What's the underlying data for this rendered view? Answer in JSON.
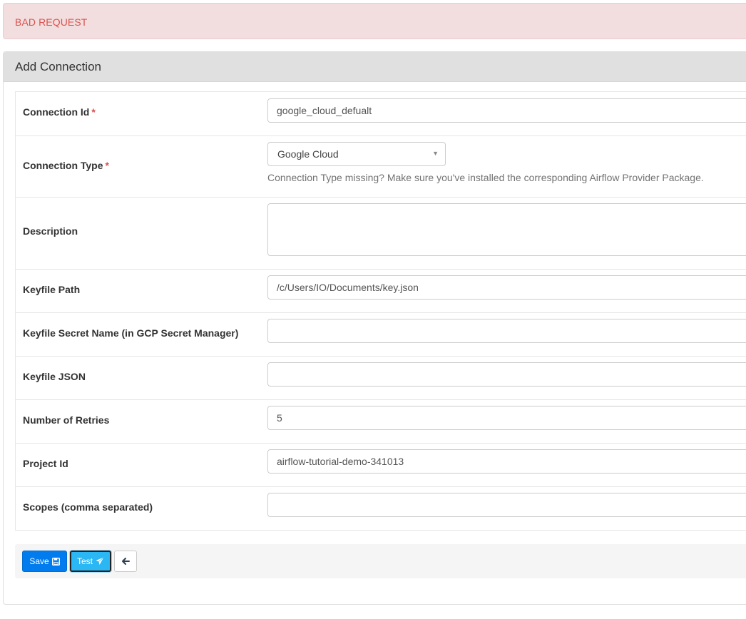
{
  "alert": {
    "text": "BAD REQUEST",
    "color": "#d9534f"
  },
  "panel": {
    "title": "Add Connection"
  },
  "form": {
    "required_mark": "*",
    "rows": [
      {
        "label": "Connection Id",
        "required": true,
        "type": "text",
        "value": "google_cloud_defualt"
      },
      {
        "label": "Connection Type",
        "required": true,
        "type": "select",
        "value": "Google Cloud",
        "help": "Connection Type missing? Make sure you've installed the corresponding Airflow Provider Package."
      },
      {
        "label": "Description",
        "required": false,
        "type": "textarea",
        "value": ""
      },
      {
        "label": "Keyfile Path",
        "required": false,
        "type": "text",
        "value": "/c/Users/IO/Documents/key.json"
      },
      {
        "label": "Keyfile Secret Name (in GCP Secret Manager)",
        "required": false,
        "type": "text",
        "value": ""
      },
      {
        "label": "Keyfile JSON",
        "required": false,
        "type": "text",
        "value": ""
      },
      {
        "label": "Number of Retries",
        "required": false,
        "type": "text",
        "value": "5"
      },
      {
        "label": "Project Id",
        "required": false,
        "type": "text",
        "value": "airflow-tutorial-demo-341013"
      },
      {
        "label": "Scopes (comma separated)",
        "required": false,
        "type": "text",
        "value": ""
      }
    ]
  },
  "actions": {
    "save_label": "Save",
    "test_label": "Test",
    "save_icon": "save-icon",
    "test_icon": "paper-plane-icon",
    "back_icon": "arrow-left-icon",
    "primary_color": "#017cee",
    "test_color": "#2ab7f4"
  }
}
